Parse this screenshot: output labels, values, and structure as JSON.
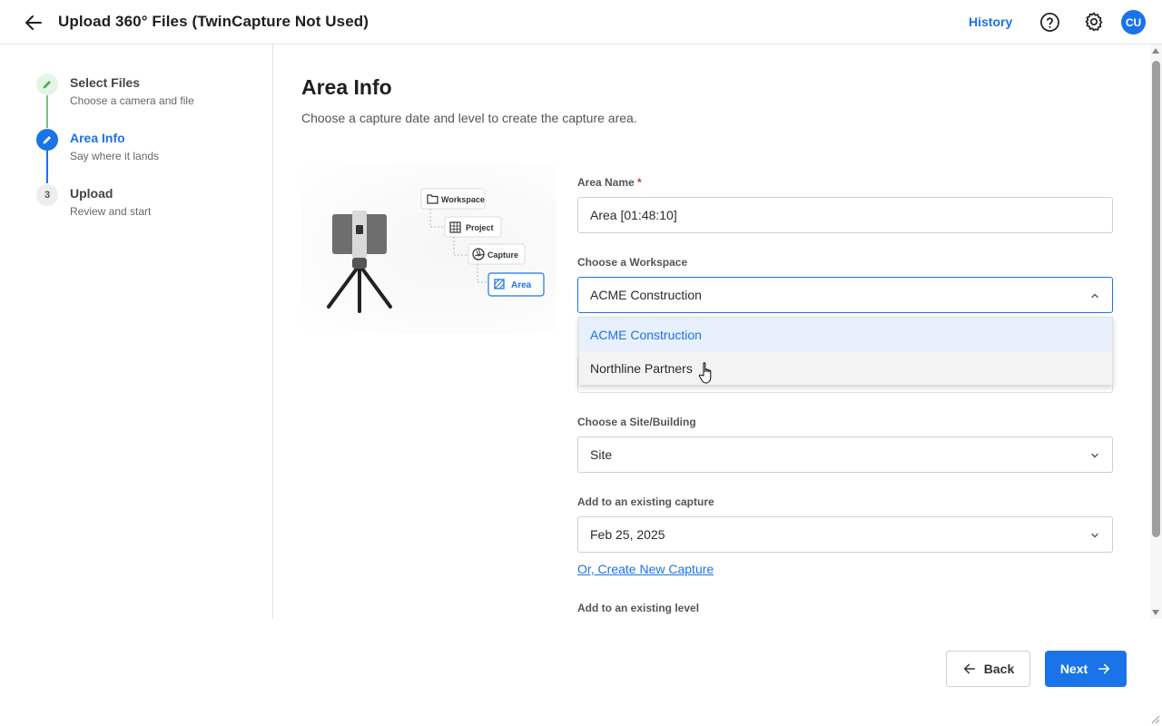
{
  "header": {
    "title": "Upload 360° Files (TwinCapture Not Used)",
    "history_label": "History",
    "avatar_initials": "CU"
  },
  "stepper": {
    "steps": [
      {
        "number": "1",
        "title": "Select Files",
        "subtitle": "Choose a camera and file",
        "state": "completed"
      },
      {
        "number": "2",
        "title": "Area Info",
        "subtitle": "Say where it lands",
        "state": "active"
      },
      {
        "number": "3",
        "title": "Upload",
        "subtitle": "Review and start",
        "state": "pending"
      }
    ]
  },
  "main": {
    "title": "Area Info",
    "subtitle": "Choose a capture date and level to create the capture area.",
    "illustration": {
      "tree_items": [
        "Workspace",
        "Project",
        "Capture",
        "Area"
      ]
    },
    "area_name": {
      "label": "Area Name",
      "required_mark": "*",
      "value": "Area [01:48:10]"
    },
    "workspace": {
      "label": "Choose a Workspace",
      "value": "ACME Construction",
      "options": [
        "ACME Construction",
        "Northline Partners"
      ]
    },
    "site": {
      "label": "Choose a Site/Building",
      "value": "Site"
    },
    "capture": {
      "label": "Add to an existing capture",
      "value": "Feb 25, 2025",
      "create_link": "Or, Create New Capture"
    },
    "level": {
      "label": "Add to an existing level"
    }
  },
  "footer": {
    "back_label": "Back",
    "next_label": "Next"
  },
  "colors": {
    "accent": "#1a73e8",
    "completed": "#4caf50",
    "required": "#d32f2f"
  }
}
